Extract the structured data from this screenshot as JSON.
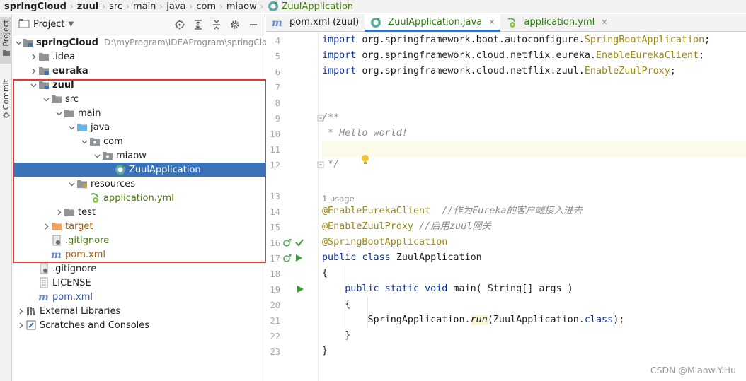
{
  "breadcrumbs": [
    {
      "label": "springCloud",
      "bold": true
    },
    {
      "label": "zuul",
      "bold": true
    },
    {
      "label": "src",
      "bold": false
    },
    {
      "label": "main",
      "bold": false
    },
    {
      "label": "java",
      "bold": false
    },
    {
      "label": "com",
      "bold": false
    },
    {
      "label": "miaow",
      "bold": false
    },
    {
      "label": "ZuulApplication",
      "bold": false
    }
  ],
  "left_strip": {
    "project_tab": "Project",
    "commit_tab": "Commit"
  },
  "project_panel": {
    "title": "Project",
    "tree": [
      {
        "label": "springCloud",
        "extra": "D:\\myProgram\\IDEAProgram\\springClou",
        "icon": "module-folder-icon",
        "arrow": "expanded",
        "style": "bold"
      },
      {
        "label": ".idea",
        "icon": "folder-icon",
        "arrow": "collapsed",
        "style": ""
      },
      {
        "label": "euraka",
        "icon": "module-folder-icon",
        "arrow": "collapsed",
        "style": "bold"
      },
      {
        "label": "zuul",
        "icon": "module-folder-icon",
        "arrow": "expanded",
        "style": "bold"
      },
      {
        "label": "src",
        "icon": "folder-icon",
        "arrow": "expanded",
        "style": ""
      },
      {
        "label": "main",
        "icon": "folder-icon",
        "arrow": "expanded",
        "style": ""
      },
      {
        "label": "java",
        "icon": "source-folder-icon",
        "arrow": "expanded",
        "style": ""
      },
      {
        "label": "com",
        "icon": "package-icon",
        "arrow": "expanded",
        "style": ""
      },
      {
        "label": "miaow",
        "icon": "package-icon",
        "arrow": "expanded",
        "style": ""
      },
      {
        "label": "ZuulApplication",
        "icon": "spring-class-icon",
        "arrow": "none",
        "style": "selected"
      },
      {
        "label": "resources",
        "icon": "resources-folder-icon",
        "arrow": "expanded",
        "style": ""
      },
      {
        "label": "application.yml",
        "icon": "yaml-file-icon",
        "arrow": "none",
        "style": "green"
      },
      {
        "label": "test",
        "icon": "folder-icon",
        "arrow": "collapsed",
        "style": ""
      },
      {
        "label": "target",
        "icon": "excluded-folder-icon",
        "arrow": "collapsed",
        "style": "orange"
      },
      {
        "label": ".gitignore",
        "icon": "gitignore-icon",
        "arrow": "none",
        "style": "green"
      },
      {
        "label": "pom.xml",
        "icon": "maven-icon",
        "arrow": "none",
        "style": "orange"
      },
      {
        "label": ".gitignore",
        "icon": "gitignore-icon",
        "arrow": "none",
        "style": ""
      },
      {
        "label": "LICENSE",
        "icon": "text-file-icon",
        "arrow": "none",
        "style": ""
      },
      {
        "label": "pom.xml",
        "icon": "maven-icon",
        "arrow": "none",
        "style": "blue"
      },
      {
        "label": "External Libraries",
        "icon": "libraries-icon",
        "arrow": "collapsed",
        "style": ""
      },
      {
        "label": "Scratches and Consoles",
        "icon": "scratches-icon",
        "arrow": "collapsed",
        "style": ""
      }
    ]
  },
  "editor": {
    "tabs": [
      {
        "label": "pom.xml (zuul)",
        "icon": "maven-icon",
        "active": false,
        "closable": false
      },
      {
        "label": "ZuulApplication.java",
        "icon": "spring-class-icon",
        "active": true,
        "closable": true
      },
      {
        "label": "application.yml",
        "icon": "yaml-file-icon",
        "active": false,
        "closable": true
      }
    ],
    "line_numbers": [
      "4",
      "5",
      "6",
      "7",
      "8",
      "9",
      "10",
      "11",
      "12",
      "13",
      "14",
      "15",
      "16",
      "17",
      "18",
      "19",
      "20",
      "21",
      "22",
      "23"
    ],
    "usage_hint": "1 usage",
    "lines": {
      "l4": {
        "kw": "import",
        "pkg": " org.springframework.boot.autoconfigure.",
        "cls": "SpringBootApplication",
        "end": ";"
      },
      "l5": {
        "kw": "import",
        "pkg": " org.springframework.cloud.netflix.eureka.",
        "cls": "EnableEurekaClient",
        "end": ";"
      },
      "l6": {
        "kw": "import",
        "pkg": " org.springframework.cloud.netflix.zuul.",
        "cls": "EnableZuulProxy",
        "end": ";"
      },
      "l8": "/**",
      "l9": " * Hello world!",
      "l11": " */",
      "l13": {
        "ann": "@EnableEurekaClient",
        "cmt": "  //作为Eureka的客户端接入进去"
      },
      "l14": {
        "ann": "@EnableZuulProxy",
        "cmt": " //启用zuul网关"
      },
      "l15": {
        "ann": "@SpringBootApplication"
      },
      "l16": {
        "kw1": "public",
        "kw2": "class",
        "name": "ZuulApplication"
      },
      "l17": "{",
      "l18": {
        "kw1": "public",
        "kw2": "static",
        "kw3": "void",
        "name": " main( String[] args )"
      },
      "l19": "{",
      "l20": {
        "pre": "SpringApplication.",
        "method": "run",
        "args": "(ZuulApplication.",
        "kw": "class",
        "end": ");"
      },
      "l21": "}",
      "l22": "}"
    }
  },
  "watermark": "CSDN @Miaow.Y.Hu",
  "colors": {
    "selection": "#3b73b9",
    "highlight_box": "#e53935",
    "keyword": "#0033b3",
    "annotation": "#9e880d",
    "comment": "#8c8c8c"
  }
}
